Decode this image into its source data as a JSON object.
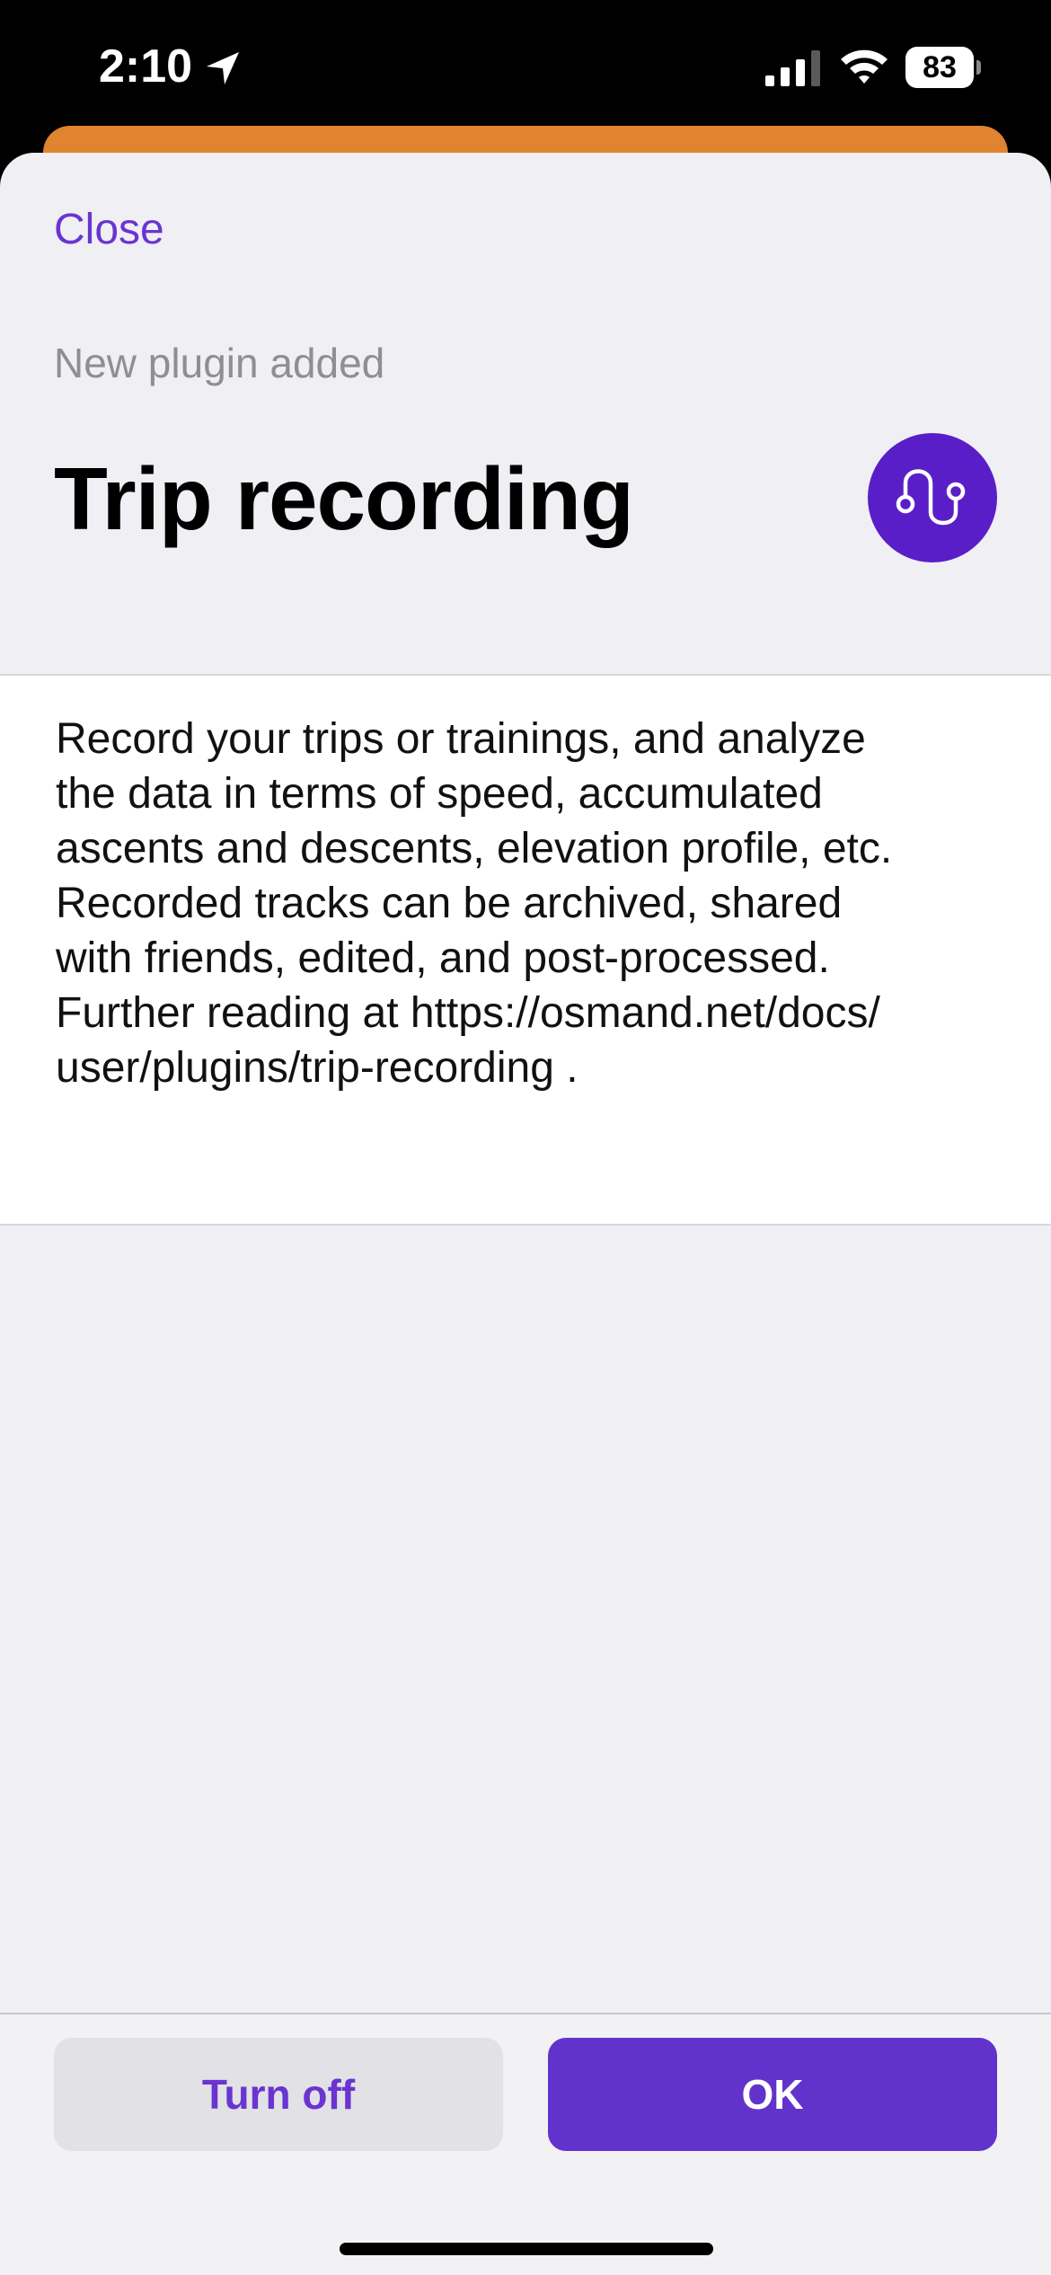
{
  "status_bar": {
    "time": "2:10",
    "battery_level": "83",
    "icons": [
      "location-arrow-icon",
      "signal-icon",
      "wifi-icon",
      "battery-icon"
    ]
  },
  "header": {
    "close_label": "Close",
    "subtitle": "New plugin added",
    "title": "Trip recording",
    "plugin_icon": "trip-route-icon"
  },
  "description": {
    "text": "Record your trips or trainings, and analyze\nthe data in terms of speed, accumulated\nascents and descents, elevation profile, etc.\nRecorded tracks can be archived, shared\nwith friends, edited, and post-processed.\nFurther reading at https://osmand.net/docs/\nuser/plugins/trip-recording ."
  },
  "actions": {
    "turn_off_label": "Turn off",
    "ok_label": "OK"
  },
  "colors": {
    "accent": "#6233cc",
    "link": "#6a34d0",
    "icon_bg": "#5a1ec8",
    "peek_orange": "#e08430"
  }
}
